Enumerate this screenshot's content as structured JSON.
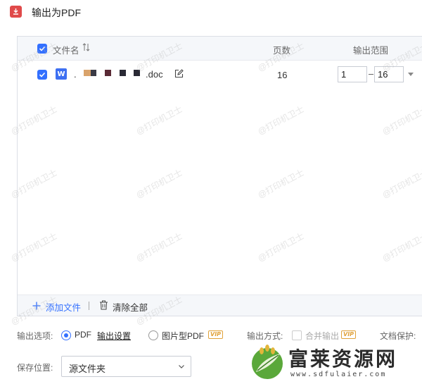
{
  "window": {
    "title": "输出为PDF"
  },
  "table": {
    "headers": {
      "filename": "文件名",
      "pages": "页数",
      "range": "输出范围"
    },
    "rows": [
      {
        "filename_visible": "doc",
        "filename_prefix": ".",
        "pages": "16",
        "range_from": "1",
        "range_to": "16"
      }
    ]
  },
  "footer": {
    "add_file": "添加文件",
    "clear_all": "清除全部"
  },
  "options": {
    "output_option_label": "输出选项:",
    "pdf_label": "PDF",
    "output_settings": "输出设置",
    "image_pdf_label": "图片型PDF",
    "vip": "VIP",
    "output_mode_label": "输出方式:",
    "merge_label": "合并输出",
    "doc_protect_label": "文档保护:",
    "save_location_label": "保存位置:",
    "save_location_value": "源文件夹"
  },
  "watermark": {
    "text": "@打印机卫士"
  },
  "logo": {
    "name": "富莱资源网",
    "url": "www.sdfulaier.com"
  },
  "colors": {
    "accent": "#3370ff",
    "vip": "#e0a23a",
    "pdf_red": "#e04a4a",
    "word_blue": "#3d6ff2"
  }
}
